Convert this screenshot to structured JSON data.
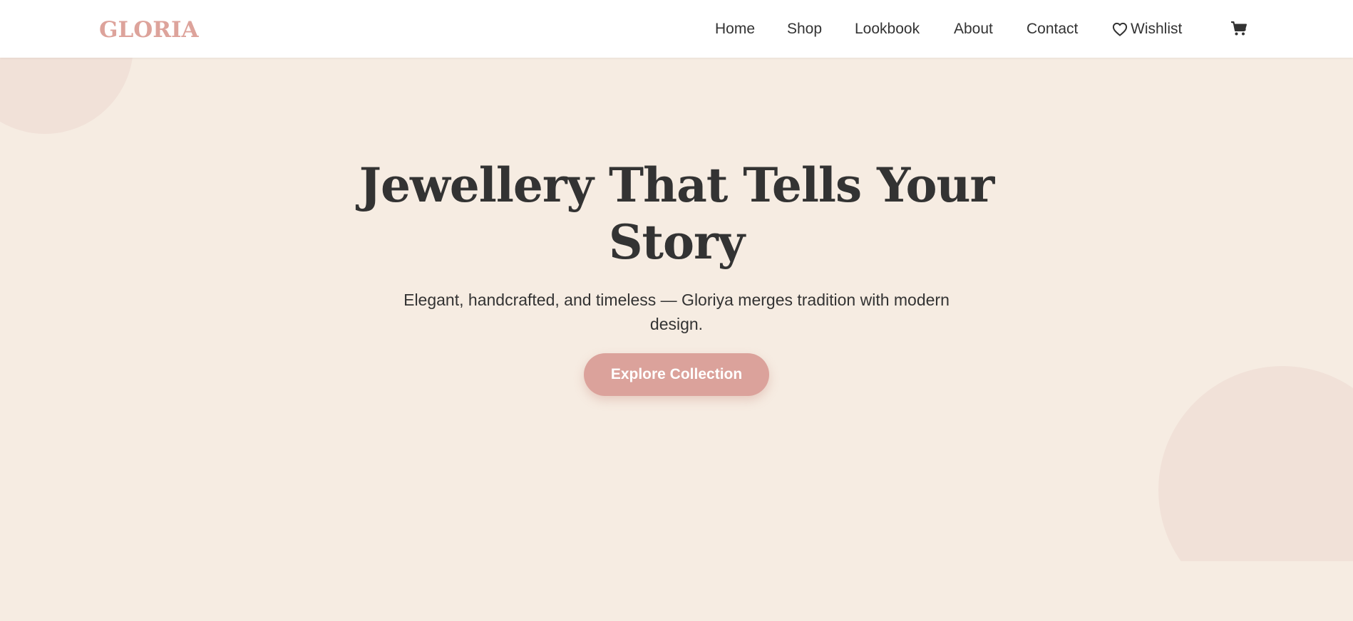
{
  "brand": {
    "logo_text": "GLORIA",
    "accent_color": "#dda39b"
  },
  "nav": {
    "items": [
      {
        "label": "Home"
      },
      {
        "label": "Shop"
      },
      {
        "label": "Lookbook"
      },
      {
        "label": "About"
      },
      {
        "label": "Contact"
      }
    ],
    "wishlist": {
      "label": "Wishlist",
      "icon": "heart-icon"
    },
    "cart": {
      "icon": "cart-icon"
    }
  },
  "hero": {
    "title": "Jewellery That Tells Your Story",
    "subtitle": "Elegant, handcrafted, and timeless — Gloriya merges tradition with modern design.",
    "cta_label": "Explore Collection",
    "background_color": "#f6ece2",
    "button_color": "#dba29b"
  }
}
